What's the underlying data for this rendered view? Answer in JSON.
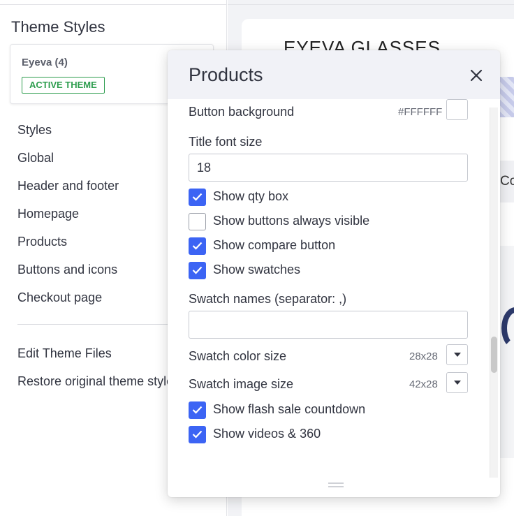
{
  "sidebar": {
    "title": "Theme Styles",
    "theme_card": {
      "name": "Eyeva (4)",
      "badge": "ACTIVE THEME"
    },
    "nav": [
      {
        "label": "Styles"
      },
      {
        "label": "Global"
      },
      {
        "label": "Header and footer"
      },
      {
        "label": "Homepage"
      },
      {
        "label": "Products"
      },
      {
        "label": "Buttons and icons"
      },
      {
        "label": "Checkout page"
      }
    ],
    "nav_secondary": [
      {
        "label": "Edit Theme Files"
      },
      {
        "label": "Restore original theme styles"
      }
    ]
  },
  "preview": {
    "brand_text": "EYEVA GLASSES",
    "band_text": "Co"
  },
  "modal": {
    "title": "Products",
    "close_icon": "close-icon",
    "fields": {
      "button_background": {
        "label": "Button background",
        "value": "#FFFFFF"
      },
      "title_font_size": {
        "label": "Title font size",
        "value": "18"
      },
      "swatch_names": {
        "label": "Swatch names (separator: ,)",
        "value": ""
      },
      "swatch_color_size": {
        "label": "Swatch color size",
        "value": "28x28"
      },
      "swatch_image_size": {
        "label": "Swatch image size",
        "value": "42x28"
      }
    },
    "checkboxes": [
      {
        "label": "Show qty box",
        "checked": true
      },
      {
        "label": "Show buttons always visible",
        "checked": false
      },
      {
        "label": "Show compare button",
        "checked": true
      },
      {
        "label": "Show swatches",
        "checked": true
      },
      {
        "label": "Show flash sale countdown",
        "checked": true
      },
      {
        "label": "Show videos & 360",
        "checked": true
      }
    ]
  },
  "colors": {
    "accent": "#3c64f4",
    "active_badge": "#2d9d4e",
    "header_bg": "#f1f2f7"
  }
}
